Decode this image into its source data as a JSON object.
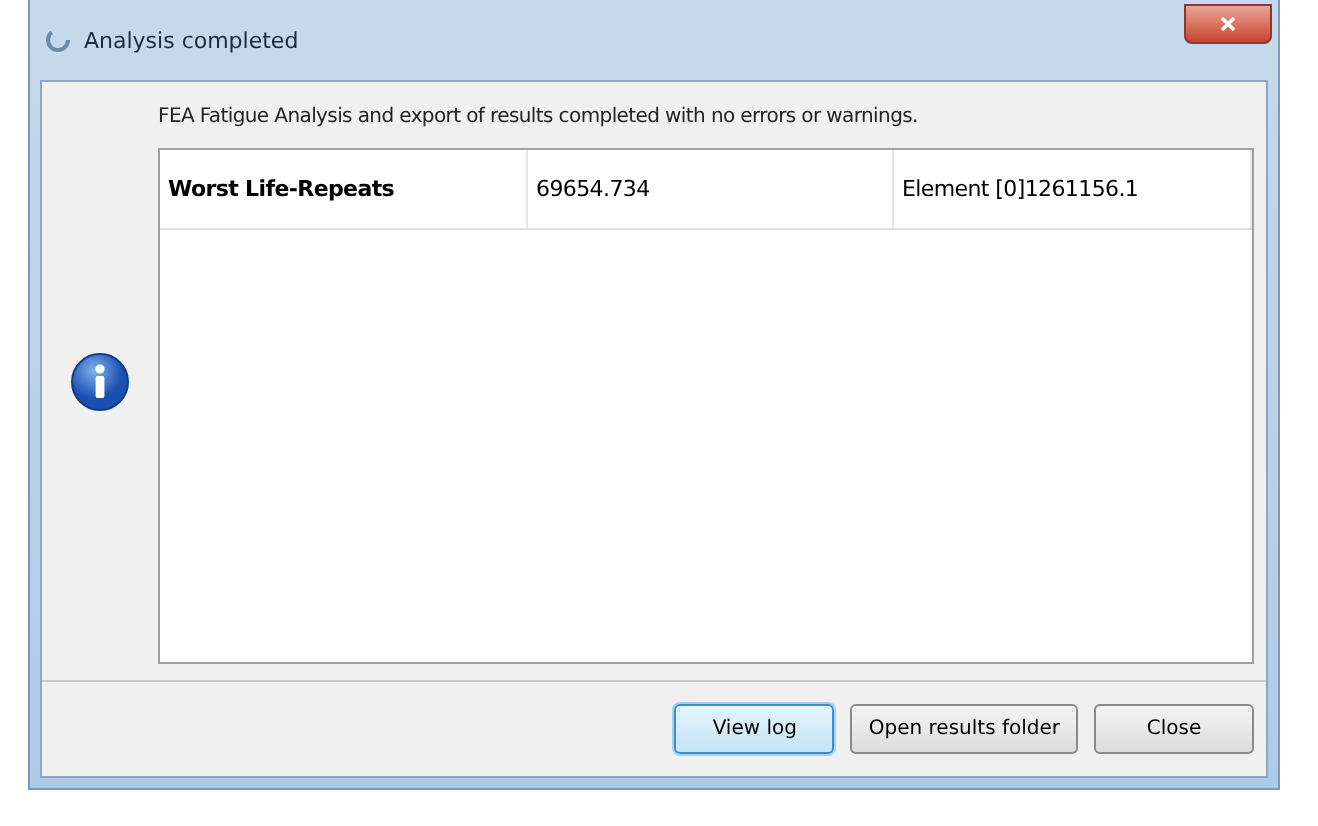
{
  "window": {
    "title": "Analysis completed"
  },
  "message": "FEA Fatigue Analysis and export of results completed with no errors or warnings.",
  "table": {
    "rows": [
      {
        "cells": [
          "Worst Life-Repeats",
          "69654.734",
          "Element [0]1261156.1"
        ]
      }
    ]
  },
  "buttons": [
    {
      "label": "View log",
      "selected": true
    },
    {
      "label": "Open results folder",
      "selected": false
    },
    {
      "label": "Close",
      "selected": false
    }
  ]
}
